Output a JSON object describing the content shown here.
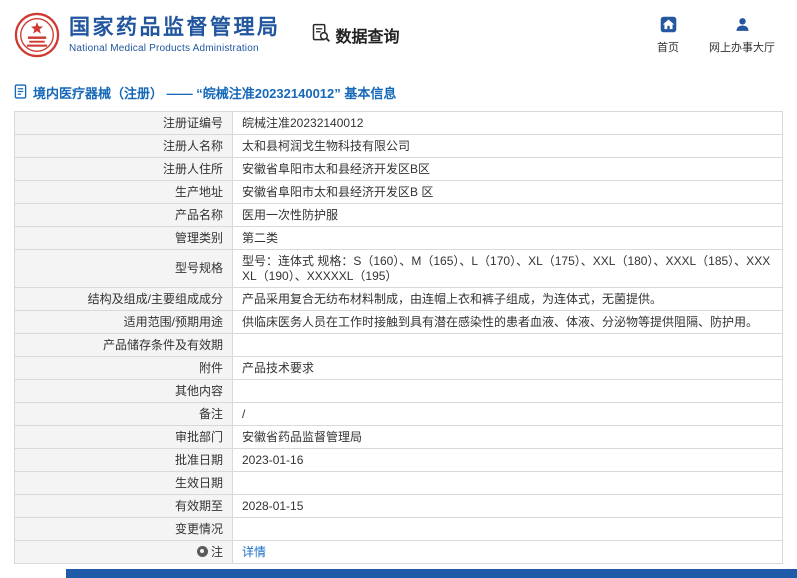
{
  "header": {
    "org_cn": "国家药品监督管理局",
    "org_en": "National Medical Products Administration",
    "section_title": "数据查询",
    "nav": {
      "home": "首页",
      "hall": "网上办事大厅"
    }
  },
  "breadcrumb": {
    "text": "境内医疗器械（注册） —— “皖械注准20232140012” 基本信息"
  },
  "table": {
    "rows": [
      {
        "label": "注册证编号",
        "value": "皖械注准20232140012"
      },
      {
        "label": "注册人名称",
        "value": "太和县柯润戈生物科技有限公司"
      },
      {
        "label": "注册人住所",
        "value": "安徽省阜阳市太和县经济开发区B区"
      },
      {
        "label": "生产地址",
        "value": "安徽省阜阳市太和县经济开发区B 区"
      },
      {
        "label": "产品名称",
        "value": "医用一次性防护服"
      },
      {
        "label": "管理类别",
        "value": "第二类"
      },
      {
        "label": "型号规格",
        "value": "型号：连体式 规格：S（160）、M（165）、L（170）、XL（175）、XXL（180）、XXXL（185）、XXXXL（190）、XXXXXL（195）"
      },
      {
        "label": "结构及组成/主要组成成分",
        "value": "产品采用复合无纺布材料制成，由连帽上衣和裤子组成，为连体式，无菌提供。"
      },
      {
        "label": "适用范围/预期用途",
        "value": "供临床医务人员在工作时接触到具有潜在感染性的患者血液、体液、分泌物等提供阻隔、防护用。"
      },
      {
        "label": "产品储存条件及有效期",
        "value": ""
      },
      {
        "label": "附件",
        "value": "产品技术要求"
      },
      {
        "label": "其他内容",
        "value": ""
      },
      {
        "label": "备注",
        "value": "/"
      },
      {
        "label": "审批部门",
        "value": "安徽省药品监督管理局"
      },
      {
        "label": "批准日期",
        "value": "2023-01-16"
      },
      {
        "label": "生效日期",
        "value": ""
      },
      {
        "label": "有效期至",
        "value": "2028-01-15"
      },
      {
        "label": "变更情况",
        "value": ""
      },
      {
        "label": "注",
        "label_icon": "note-icon",
        "value": "详情",
        "link": true
      }
    ]
  },
  "colors": {
    "brand_blue": "#21569f",
    "breadcrumb_blue": "#1668b8",
    "link_blue": "#1a6fc9",
    "emblem_red": "#cf3a32",
    "footer_blue": "#1f5ba8",
    "label_cell_bg": "#f4f4f4"
  }
}
